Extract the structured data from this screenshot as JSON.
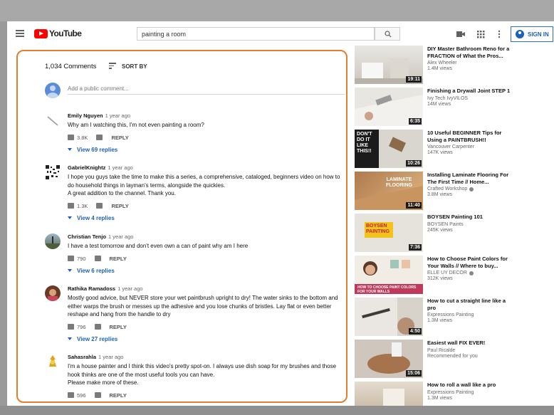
{
  "header": {
    "search_value": "painting a room",
    "signin_label": "SIGN IN",
    "logo_text": "YouTube"
  },
  "comments": {
    "count_label": "1,034 Comments",
    "sort_label": "SORT BY",
    "add_placeholder": "Add a public comment...",
    "reply_label": "REPLY",
    "items": [
      {
        "author": "Emily Nguyen",
        "ago": "1 year ago",
        "text": "Why am I watching this, I'm not even painting a room?",
        "likes": "3.8K",
        "replies": "View 69 replies"
      },
      {
        "author": "GabrielKnightz",
        "ago": "1 year ago",
        "text": "I hope you guys take the time to make this a series, a comprehensive, cataloged, beginners video on how to do household things in layman's terms, alongside the quickies.\nA  great addition to the channel. Thank you.",
        "likes": "1.3K",
        "replies": "View 4 replies"
      },
      {
        "author": "Christian Tenjo",
        "ago": "1 year ago",
        "text": "I have a test tomorrow and don't even own a can of paint why am I here",
        "likes": "790",
        "replies": "View 6 replies"
      },
      {
        "author": "Rathika Ramadoss",
        "ago": "1 year ago",
        "text": "Mostly good advice, but NEVER store your wet paintbrush upright to dry! The water sinks to the bottom and either warps the brush or messes up the adhesive and you lose chunks of bristles. Lay flat or even better reshape and hang from the handle to dry",
        "likes": "796",
        "replies": "View 27 replies"
      },
      {
        "author": "Sahasrahla",
        "ago": "1 year ago",
        "text": "I'm a house painter and I think this video's pretty spot-on. I always use dish soap for my brushes and those hook thinks are one of the most useful tools you can have.\nPlease make more of these.",
        "likes": "596",
        "replies": ""
      }
    ]
  },
  "sidebar": {
    "videos": [
      {
        "title": "DIY Master Bathroom Reno for a FRACTION of What the Pros...",
        "channel": "Alex Wheeler",
        "views": "1.4M views",
        "duration": "19:11"
      },
      {
        "title": "Finishing a Drywall Joint STEP 1",
        "channel": "Ivy Tech IvyVILOS",
        "views": "14M views",
        "duration": "6:35"
      },
      {
        "title": "10 Useful BEGINNER Tips for Using a PAINTBRUSH!!",
        "channel": "Vancouver Carpenter",
        "views": "147K views",
        "duration": "10:26",
        "thumb_text": "DON'T\nDO IT\nLIKE\nTHIS!!"
      },
      {
        "title": "Installing Laminate Flooring For The First Time // Home...",
        "channel": "Crafted Workshop",
        "views": "3.8M views",
        "duration": "11:40",
        "thumb_text": "LAMINATE\nFLOORING"
      },
      {
        "title": "BOYSEN Painting 101",
        "channel": "BOYSEN Paints",
        "views": "245K views",
        "duration": "7:36",
        "thumb_text": "BOYSEN\nPAINTING"
      },
      {
        "title": "How to Choose Paint Colors for Your Walls // Where to buy...",
        "channel": "ELLE UY DECOR",
        "views": "312K views",
        "duration": "",
        "thumb_text": "HOW TO CHOOSE PAINT COLORS\nFOR YOUR WALLS"
      },
      {
        "title": "How to cut a straight line like a pro",
        "channel": "Expressions Painting",
        "views": "1.3M views",
        "duration": "4:50"
      },
      {
        "title": "Easiest wall FIX EVER!",
        "channel": "Paul Ricalde",
        "views": "Recommended for you",
        "duration": "15:06"
      },
      {
        "title": "How to roll a wall like a pro",
        "channel": "Expressions Painting",
        "views": "1.3M views",
        "duration": ""
      }
    ]
  },
  "colors": {
    "accent_border": "#e67c2e",
    "link_blue": "#1c62b9",
    "brand_red": "#ff0000"
  }
}
